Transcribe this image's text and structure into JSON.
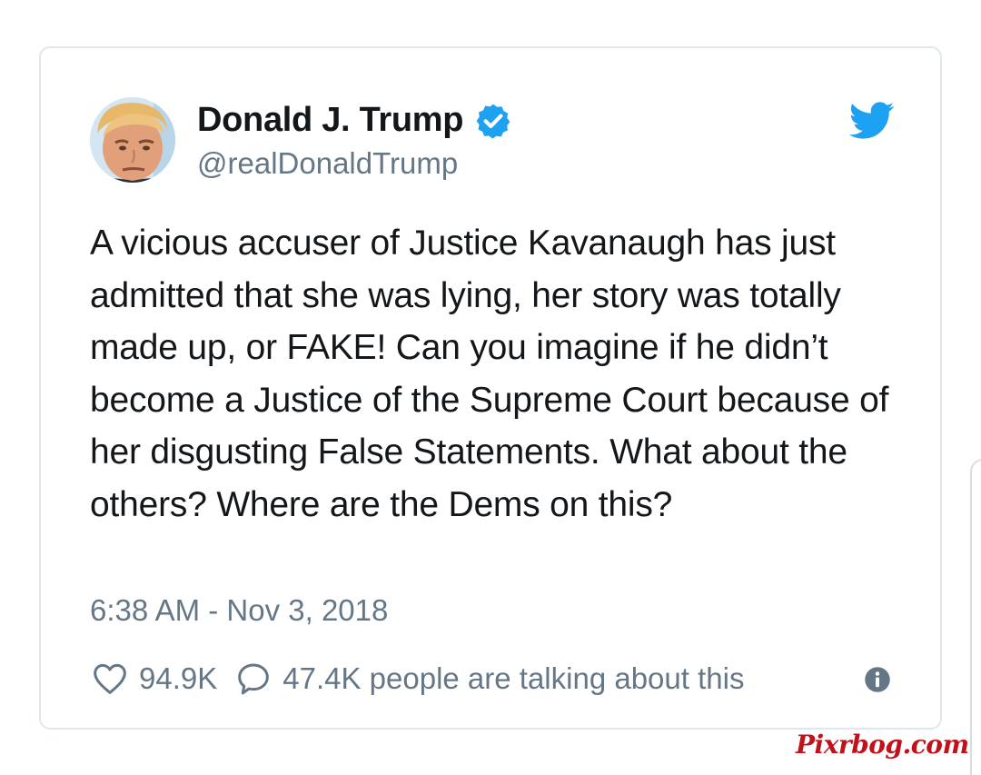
{
  "tweet": {
    "author": {
      "display_name": "Donald J. Trump",
      "handle": "@realDonaldTrump",
      "verified": true,
      "avatar_icon": "profile-photo"
    },
    "text": "A vicious accuser of Justice Kavanaugh has just admitted that she was lying, her story was totally made up, or FAKE! Can you imagine if he didn’t become a Justice of the Supreme Court because of her disgusting False Statements. What about the others? Where are the Dems on this?",
    "timestamp": "6:38 AM - Nov 3, 2018",
    "likes": "94.9K",
    "talking": "47.4K people are talking about this",
    "icons": {
      "like": "heart-icon",
      "reply": "reply-bubble-icon",
      "info": "info-icon",
      "brand": "twitter-bird-icon",
      "verified": "verified-badge-icon"
    }
  },
  "watermark": "Pixrbog.com",
  "colors": {
    "text_primary": "#14171a",
    "text_secondary": "#657786",
    "twitter_blue": "#1da1f2",
    "card_border": "#e1e8ed",
    "watermark_red": "#c1121b"
  }
}
